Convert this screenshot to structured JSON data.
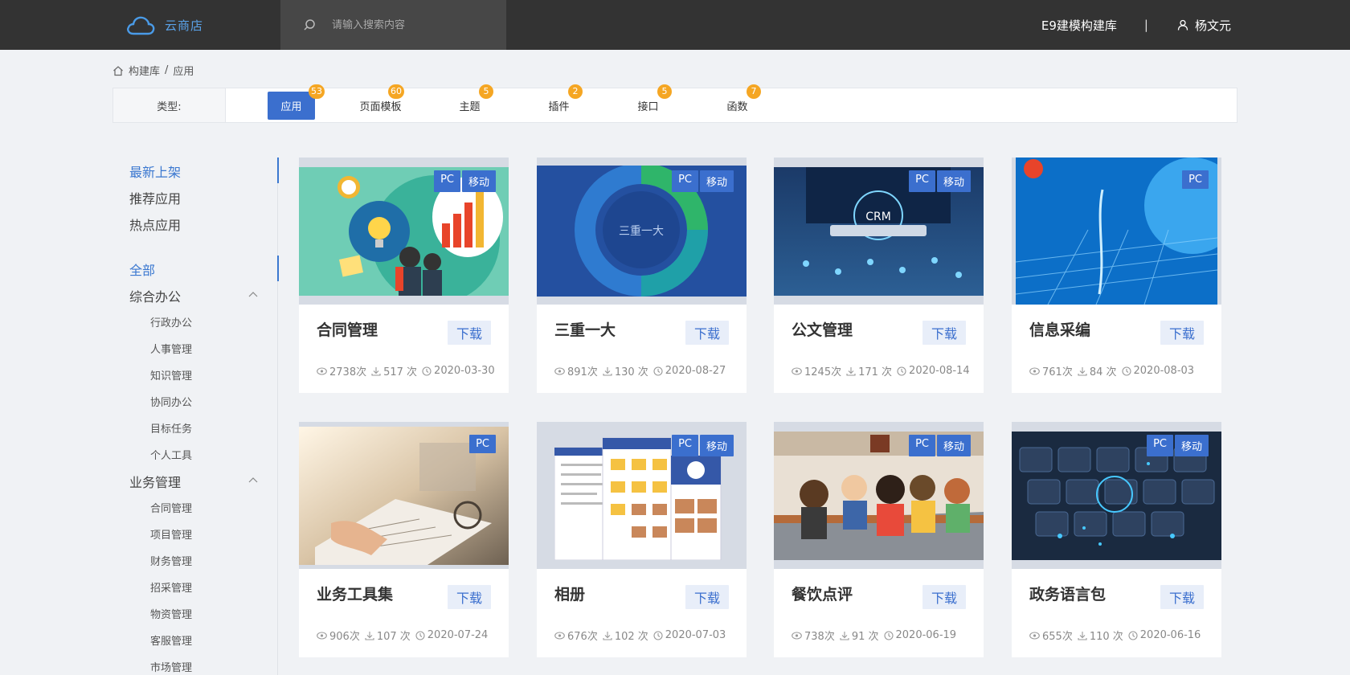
{
  "app": {
    "name": "云商店"
  },
  "search": {
    "placeholder": "请输入搜索内容"
  },
  "header": {
    "library": "E9建模构建库",
    "separator": "|",
    "user": "杨文元"
  },
  "breadcrumb": {
    "root": "构建库",
    "sep": "/",
    "current": "应用"
  },
  "types": {
    "label": "类型:",
    "tabs": [
      {
        "label": "应用",
        "count": "53"
      },
      {
        "label": "页面模板",
        "count": "60"
      },
      {
        "label": "主题",
        "count": "5"
      },
      {
        "label": "插件",
        "count": "2"
      },
      {
        "label": "接口",
        "count": "5"
      },
      {
        "label": "函数",
        "count": "7"
      }
    ]
  },
  "sidebar": {
    "top": [
      "最新上架",
      "推荐应用",
      "热点应用"
    ],
    "all": "全部",
    "groups": [
      {
        "label": "综合办公",
        "items": [
          "行政办公",
          "人事管理",
          "知识管理",
          "协同办公",
          "目标任务",
          "个人工具"
        ]
      },
      {
        "label": "业务管理",
        "items": [
          "合同管理",
          "项目管理",
          "财务管理",
          "招采管理",
          "物资管理",
          "客服管理",
          "市场管理"
        ]
      }
    ]
  },
  "cards": [
    {
      "title": "合同管理",
      "tags": [
        "PC",
        "移动"
      ],
      "download": "下载",
      "views": "2738次",
      "downloads": "517 次",
      "date": "2020-03-30"
    },
    {
      "title": "三重一大",
      "tags": [
        "PC",
        "移动"
      ],
      "download": "下载",
      "views": "891次",
      "downloads": "130 次",
      "date": "2020-08-27",
      "art_text": "三重一大"
    },
    {
      "title": "公文管理",
      "tags": [
        "PC",
        "移动"
      ],
      "download": "下载",
      "views": "1245次",
      "downloads": "171 次",
      "date": "2020-08-14",
      "art_text": "CRM"
    },
    {
      "title": "信息采编",
      "tags": [
        "PC"
      ],
      "download": "下载",
      "views": "761次",
      "downloads": "84 次",
      "date": "2020-08-03"
    },
    {
      "title": "业务工具集",
      "tags": [
        "PC"
      ],
      "download": "下载",
      "views": "906次",
      "downloads": "107 次",
      "date": "2020-07-24"
    },
    {
      "title": "相册",
      "tags": [
        "PC",
        "移动"
      ],
      "download": "下载",
      "views": "676次",
      "downloads": "102 次",
      "date": "2020-07-03"
    },
    {
      "title": "餐饮点评",
      "tags": [
        "PC",
        "移动"
      ],
      "download": "下载",
      "views": "738次",
      "downloads": "91 次",
      "date": "2020-06-19"
    },
    {
      "title": "政务语言包",
      "tags": [
        "PC",
        "移动"
      ],
      "download": "下载",
      "views": "655次",
      "downloads": "110 次",
      "date": "2020-06-16"
    }
  ],
  "colors": {
    "accent": "#3b6fce",
    "badge": "#f5a623",
    "topbar": "#333333",
    "page_bg": "#f0f2f5"
  }
}
